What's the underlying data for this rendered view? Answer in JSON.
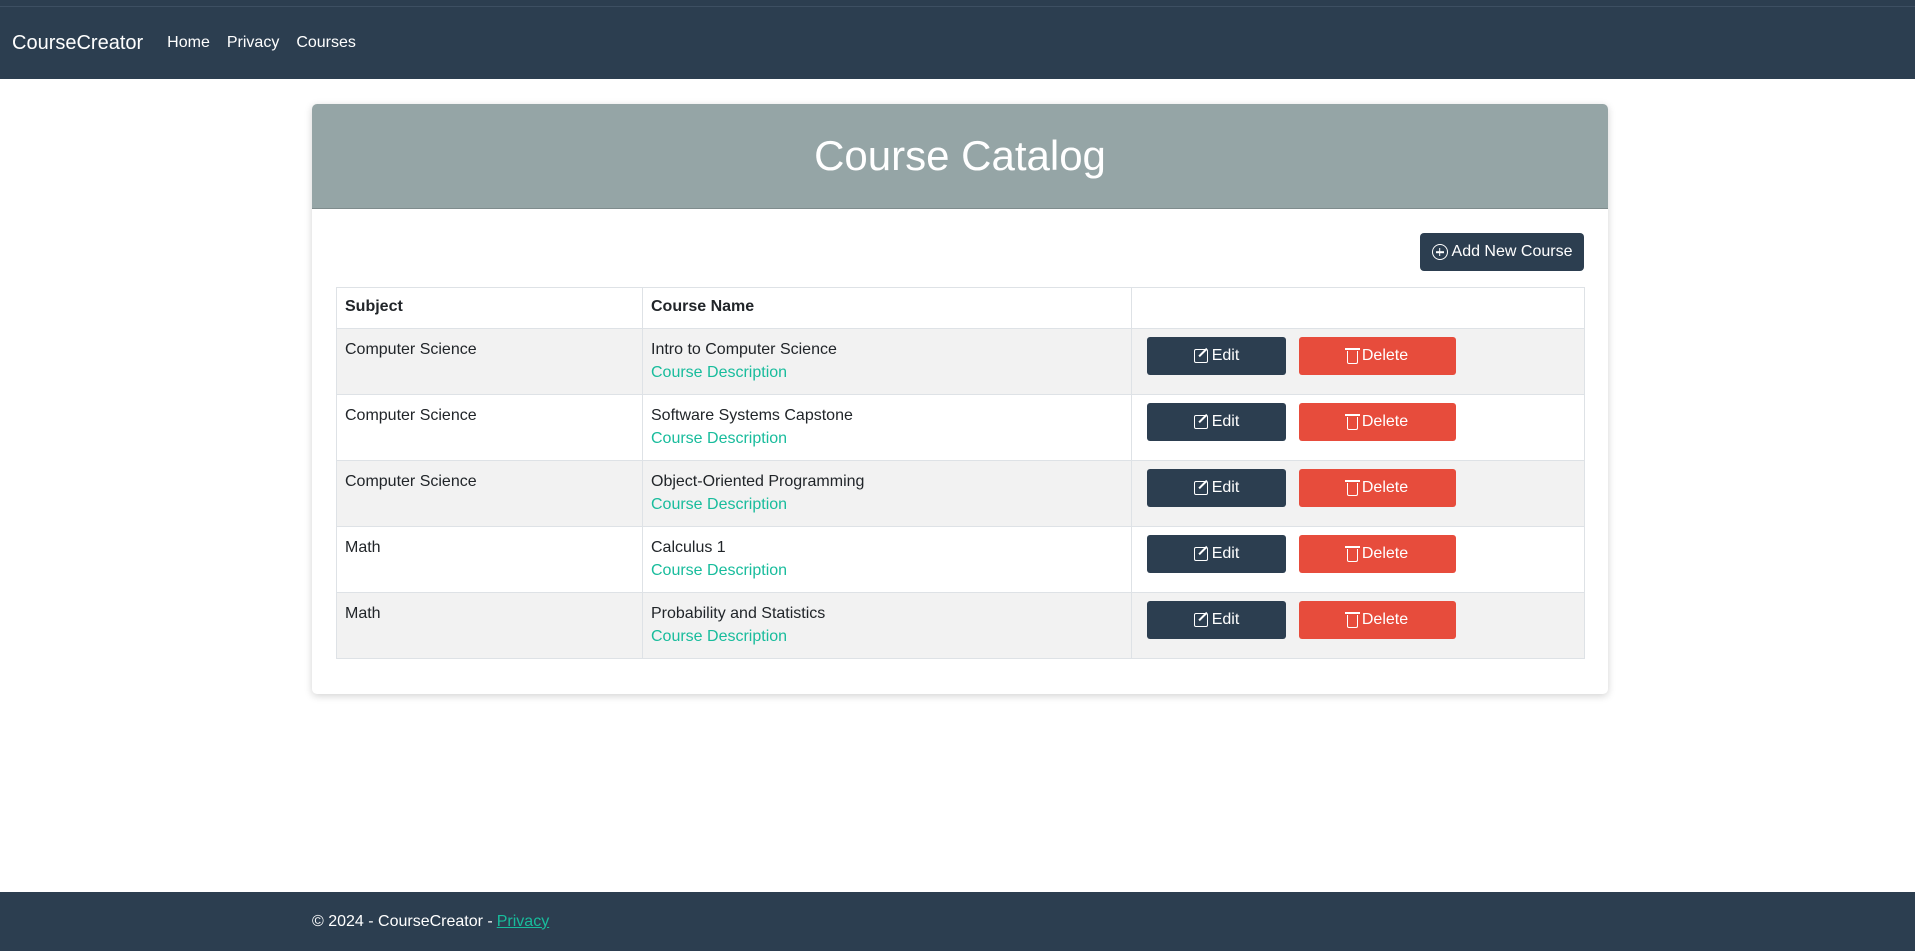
{
  "nav": {
    "brand": "CourseCreator",
    "links": [
      "Home",
      "Privacy",
      "Courses"
    ]
  },
  "card": {
    "title": "Course Catalog",
    "add_button_label": "Add New Course"
  },
  "table": {
    "headers": [
      "Subject",
      "Course Name",
      ""
    ],
    "rows": [
      {
        "subject": "Computer Science",
        "name": "Intro to Computer Science",
        "link": "Course Description"
      },
      {
        "subject": "Computer Science",
        "name": "Software Systems Capstone",
        "link": "Course Description"
      },
      {
        "subject": "Computer Science",
        "name": "Object-Oriented Programming",
        "link": "Course Description"
      },
      {
        "subject": "Math",
        "name": "Calculus 1",
        "link": "Course Description"
      },
      {
        "subject": "Math",
        "name": "Probability and Statistics",
        "link": "Course Description"
      }
    ],
    "edit_label": "Edit",
    "delete_label": "Delete"
  },
  "footer": {
    "text": "© 2024 - CourseCreator -",
    "link": "Privacy"
  },
  "colors": {
    "primary": "#2c3e50",
    "danger": "#e74c3c",
    "link": "#18bc9c",
    "header_bg": "#95a5a6"
  }
}
